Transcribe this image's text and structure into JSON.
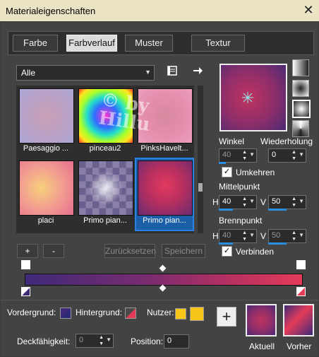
{
  "window": {
    "title": "Materialeigenschaften",
    "close_symbol": "✕"
  },
  "tabs": [
    {
      "label": "Farbe",
      "active": false
    },
    {
      "label": "Farbverlauf",
      "active": true
    },
    {
      "label": "Muster",
      "active": false
    },
    {
      "label": "Textur",
      "active": false
    }
  ],
  "category": {
    "value": "Alle",
    "options_icon": "library-icon",
    "nav_icon": "arrow-right-icon"
  },
  "gallery": {
    "items": [
      {
        "label": "Paesaggio ...",
        "selected": false
      },
      {
        "label": "pinceau2",
        "selected": false
      },
      {
        "label": "PinksHavelt...",
        "selected": false
      },
      {
        "label": "placi",
        "selected": false
      },
      {
        "label": "Primo pian...",
        "selected": false
      },
      {
        "label": "Primo pian...",
        "selected": true
      }
    ],
    "watermark": "© by Hillu"
  },
  "buttons": {
    "add": "+",
    "remove": "-",
    "reset": "Zurücksetzen",
    "save": "Speichern"
  },
  "angle": {
    "label": "Winkel",
    "value": "40"
  },
  "repeat": {
    "label": "Wiederholung",
    "value": "0"
  },
  "invert": {
    "label": "Umkehren",
    "checked": true
  },
  "center": {
    "label": "Mittelpunkt",
    "h_label": "H",
    "h_value": "40",
    "v_label": "V",
    "v_value": "50"
  },
  "focal": {
    "label": "Brennpunkt",
    "h_label": "H",
    "h_value": "40",
    "v_label": "V",
    "v_value": "50"
  },
  "link": {
    "label": "Verbinden",
    "checked": true
  },
  "footer": {
    "foreground_label": "Vordergrund:",
    "background_label": "Hintergrund:",
    "user_label": "Nutzer:",
    "opacity_label": "Deckfähigkeit:",
    "opacity_value": "0",
    "position_label": "Position:",
    "position_value": "0",
    "current_label": "Aktuell",
    "previous_label": "Vorher"
  },
  "colors": {
    "accent": "#2a82e2",
    "gradient_start": "#3f2a78",
    "gradient_end": "#e53b59",
    "user_color": "#f5c518"
  }
}
